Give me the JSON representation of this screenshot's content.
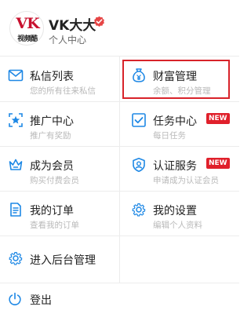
{
  "profile": {
    "username": "VK大大",
    "subtitle": "个人中心",
    "avatar_logo": "VK",
    "avatar_caption": "视频酷"
  },
  "colors": {
    "accent": "#1e88e5",
    "badge": "#e0202b",
    "highlight": "#d8232a"
  },
  "menu": [
    {
      "label": "私信列表",
      "sub": "您的所有往来私信",
      "icon": "mail-icon"
    },
    {
      "label": "财富管理",
      "sub": "余额、积分管理",
      "icon": "wealth-bag-icon"
    },
    {
      "label": "推广中心",
      "sub": "推广有奖励",
      "icon": "promote-star-icon"
    },
    {
      "label": "任务中心",
      "sub": "每日任务",
      "icon": "task-check-icon",
      "badge": "NEW"
    },
    {
      "label": "成为会员",
      "sub": "购买付费会员",
      "icon": "crown-icon"
    },
    {
      "label": "认证服务",
      "sub": "申请成为认证会员",
      "icon": "shield-user-icon",
      "badge": "NEW"
    },
    {
      "label": "我的订单",
      "sub": "查看我的订单",
      "icon": "order-doc-icon"
    },
    {
      "label": "我的设置",
      "sub": "编辑个人资料",
      "icon": "gear-icon"
    },
    {
      "label": "进入后台管理",
      "sub": "",
      "icon": "admin-gear-icon"
    }
  ],
  "logout": {
    "label": "登出",
    "icon": "power-icon"
  }
}
